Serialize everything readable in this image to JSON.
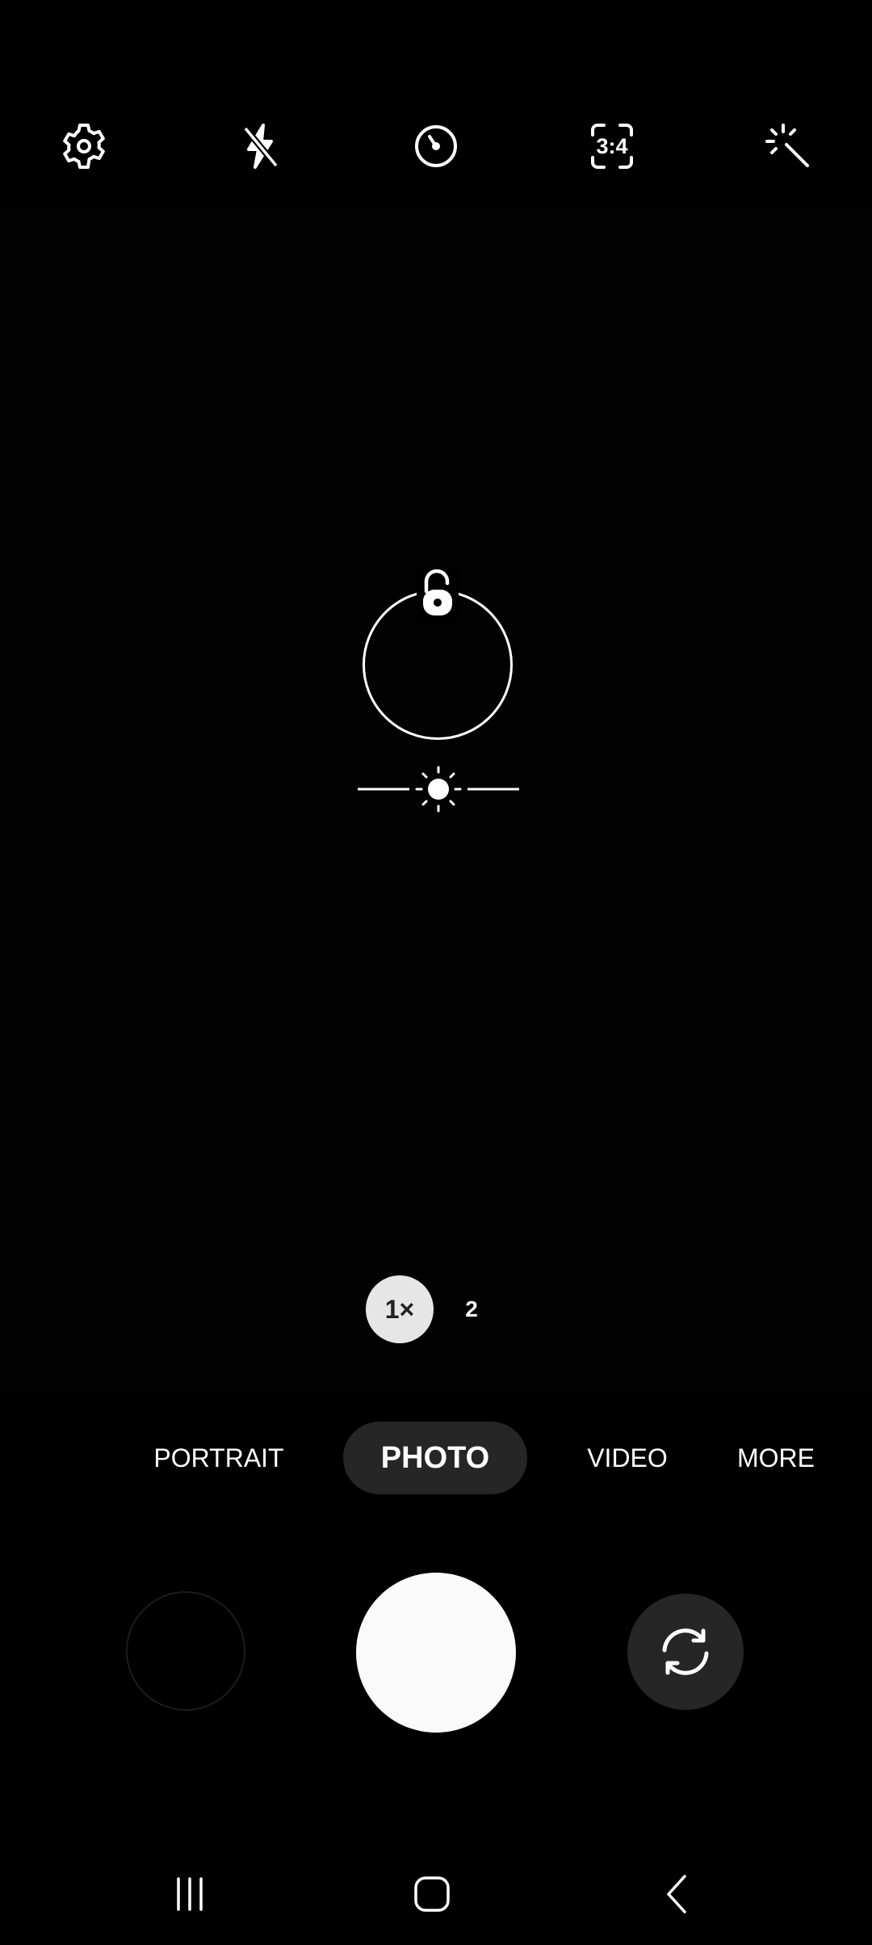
{
  "top_bar": {
    "icons": [
      "gear-icon",
      "flash-off-icon",
      "timer-icon",
      "aspect-ratio-icon",
      "magic-wand-icon"
    ],
    "aspect_ratio_label": "3:4"
  },
  "focus": {
    "lock_icon": "unlocked-padlock-icon",
    "exposure_icon": "sun-icon"
  },
  "zoom": {
    "selected_label": "1×",
    "other_label": "2"
  },
  "modes": {
    "items": [
      "PORTRAIT",
      "PHOTO",
      "VIDEO",
      "MORE"
    ],
    "selected": "PHOTO"
  },
  "controls": {
    "gallery_icon": "gallery-thumbnail",
    "shutter_icon": "shutter-button",
    "switch_icon": "switch-camera-icon"
  },
  "nav": {
    "icons": [
      "recent-apps-icon",
      "home-icon",
      "back-icon"
    ]
  },
  "colors": {
    "background": "#000000",
    "pill": "#262626",
    "zoom_selected_bg": "#e6e6e6",
    "shutter": "#fafafa"
  }
}
